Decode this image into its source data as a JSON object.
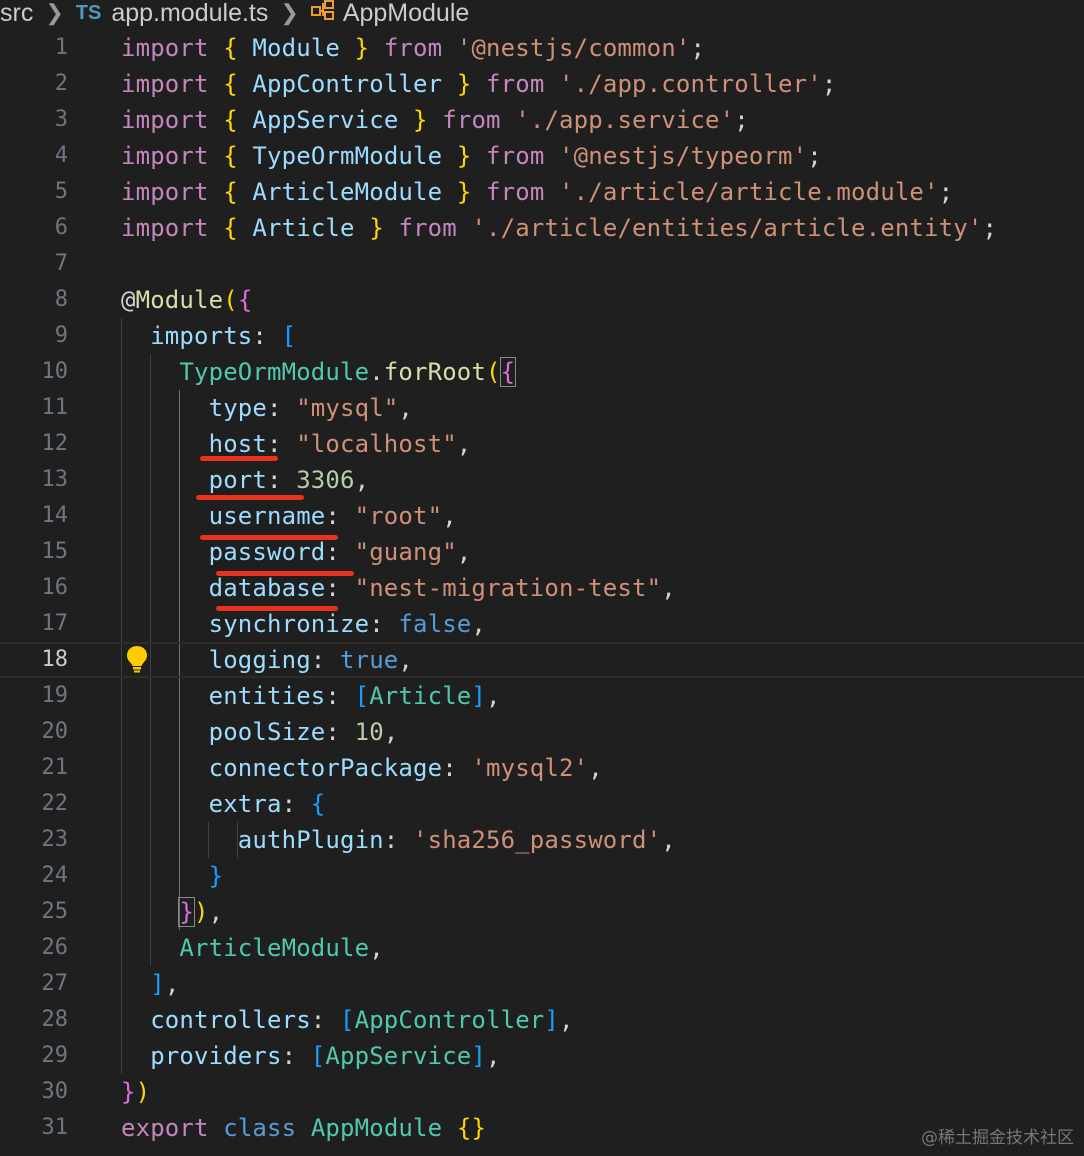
{
  "breadcrumb": {
    "folder": "src",
    "file_icon": "TS",
    "file": "app.module.ts",
    "symbol_icon": "class-icon",
    "symbol": "AppModule"
  },
  "editor": {
    "current_line": 18,
    "line_numbers": [
      "1",
      "2",
      "3",
      "4",
      "5",
      "6",
      "7",
      "8",
      "9",
      "10",
      "11",
      "12",
      "13",
      "14",
      "15",
      "16",
      "17",
      "18",
      "19",
      "20",
      "21",
      "22",
      "23",
      "24",
      "25",
      "26",
      "27",
      "28",
      "29",
      "30",
      "31"
    ],
    "lines": [
      [
        {
          "t": "import",
          "c": "kw"
        },
        {
          "t": " ",
          "c": "punc"
        },
        {
          "t": "{",
          "c": "br"
        },
        {
          "t": " Module ",
          "c": "var"
        },
        {
          "t": "}",
          "c": "br"
        },
        {
          "t": " from ",
          "c": "kw"
        },
        {
          "t": "'@nestjs/common'",
          "c": "str"
        },
        {
          "t": ";",
          "c": "punc"
        }
      ],
      [
        {
          "t": "import",
          "c": "kw"
        },
        {
          "t": " ",
          "c": "punc"
        },
        {
          "t": "{",
          "c": "br"
        },
        {
          "t": " AppController ",
          "c": "var"
        },
        {
          "t": "}",
          "c": "br"
        },
        {
          "t": " from ",
          "c": "kw"
        },
        {
          "t": "'./app.controller'",
          "c": "str"
        },
        {
          "t": ";",
          "c": "punc"
        }
      ],
      [
        {
          "t": "import",
          "c": "kw"
        },
        {
          "t": " ",
          "c": "punc"
        },
        {
          "t": "{",
          "c": "br"
        },
        {
          "t": " AppService ",
          "c": "var"
        },
        {
          "t": "}",
          "c": "br"
        },
        {
          "t": " from ",
          "c": "kw"
        },
        {
          "t": "'./app.service'",
          "c": "str"
        },
        {
          "t": ";",
          "c": "punc"
        }
      ],
      [
        {
          "t": "import",
          "c": "kw"
        },
        {
          "t": " ",
          "c": "punc"
        },
        {
          "t": "{",
          "c": "br"
        },
        {
          "t": " TypeOrmModule ",
          "c": "var"
        },
        {
          "t": "}",
          "c": "br"
        },
        {
          "t": " from ",
          "c": "kw"
        },
        {
          "t": "'@nestjs/typeorm'",
          "c": "str"
        },
        {
          "t": ";",
          "c": "punc"
        }
      ],
      [
        {
          "t": "import",
          "c": "kw"
        },
        {
          "t": " ",
          "c": "punc"
        },
        {
          "t": "{",
          "c": "br"
        },
        {
          "t": " ArticleModule ",
          "c": "var"
        },
        {
          "t": "}",
          "c": "br"
        },
        {
          "t": " from ",
          "c": "kw"
        },
        {
          "t": "'./article/article.module'",
          "c": "str"
        },
        {
          "t": ";",
          "c": "punc"
        }
      ],
      [
        {
          "t": "import",
          "c": "kw"
        },
        {
          "t": " ",
          "c": "punc"
        },
        {
          "t": "{",
          "c": "br"
        },
        {
          "t": " Article ",
          "c": "var"
        },
        {
          "t": "}",
          "c": "br"
        },
        {
          "t": " from ",
          "c": "kw"
        },
        {
          "t": "'./article/entities/article.entity'",
          "c": "str"
        },
        {
          "t": ";",
          "c": "punc"
        }
      ],
      [],
      [
        {
          "t": "@",
          "c": "punc"
        },
        {
          "t": "Module",
          "c": "dec"
        },
        {
          "t": "(",
          "c": "br"
        },
        {
          "t": "{",
          "c": "br2"
        }
      ],
      [
        {
          "t": "  imports",
          "c": "var"
        },
        {
          "t": ": ",
          "c": "punc"
        },
        {
          "t": "[",
          "c": "br3"
        }
      ],
      [
        {
          "t": "    TypeOrmModule",
          "c": "cls"
        },
        {
          "t": ".",
          "c": "punc"
        },
        {
          "t": "forRoot",
          "c": "fn"
        },
        {
          "t": "(",
          "c": "br"
        },
        {
          "t": "{",
          "c": "br2 bracket-box"
        }
      ],
      [
        {
          "t": "      type",
          "c": "var"
        },
        {
          "t": ": ",
          "c": "punc"
        },
        {
          "t": "\"mysql\"",
          "c": "str"
        },
        {
          "t": ",",
          "c": "punc"
        }
      ],
      [
        {
          "t": "      host",
          "c": "var"
        },
        {
          "t": ": ",
          "c": "punc"
        },
        {
          "t": "\"localhost\"",
          "c": "str"
        },
        {
          "t": ",",
          "c": "punc"
        }
      ],
      [
        {
          "t": "      port",
          "c": "var"
        },
        {
          "t": ": ",
          "c": "punc"
        },
        {
          "t": "3306",
          "c": "num"
        },
        {
          "t": ",",
          "c": "punc"
        }
      ],
      [
        {
          "t": "      username",
          "c": "var"
        },
        {
          "t": ": ",
          "c": "punc"
        },
        {
          "t": "\"root\"",
          "c": "str"
        },
        {
          "t": ",",
          "c": "punc"
        }
      ],
      [
        {
          "t": "      password",
          "c": "var"
        },
        {
          "t": ": ",
          "c": "punc"
        },
        {
          "t": "\"guang\"",
          "c": "str"
        },
        {
          "t": ",",
          "c": "punc"
        }
      ],
      [
        {
          "t": "      database",
          "c": "var"
        },
        {
          "t": ": ",
          "c": "punc"
        },
        {
          "t": "\"nest-migration-test\"",
          "c": "str"
        },
        {
          "t": ",",
          "c": "punc"
        }
      ],
      [
        {
          "t": "      synchronize",
          "c": "var"
        },
        {
          "t": ": ",
          "c": "punc"
        },
        {
          "t": "false",
          "c": "bool"
        },
        {
          "t": ",",
          "c": "punc"
        }
      ],
      [
        {
          "t": "      logging",
          "c": "var"
        },
        {
          "t": ": ",
          "c": "punc"
        },
        {
          "t": "true",
          "c": "bool"
        },
        {
          "t": ",",
          "c": "punc"
        }
      ],
      [
        {
          "t": "      entities",
          "c": "var"
        },
        {
          "t": ": ",
          "c": "punc"
        },
        {
          "t": "[",
          "c": "br3"
        },
        {
          "t": "Article",
          "c": "cls"
        },
        {
          "t": "]",
          "c": "br3"
        },
        {
          "t": ",",
          "c": "punc"
        }
      ],
      [
        {
          "t": "      poolSize",
          "c": "var"
        },
        {
          "t": ": ",
          "c": "punc"
        },
        {
          "t": "10",
          "c": "num"
        },
        {
          "t": ",",
          "c": "punc"
        }
      ],
      [
        {
          "t": "      connectorPackage",
          "c": "var"
        },
        {
          "t": ": ",
          "c": "punc"
        },
        {
          "t": "'mysql2'",
          "c": "str"
        },
        {
          "t": ",",
          "c": "punc"
        }
      ],
      [
        {
          "t": "      extra",
          "c": "var"
        },
        {
          "t": ": ",
          "c": "punc"
        },
        {
          "t": "{",
          "c": "br3"
        }
      ],
      [
        {
          "t": "        authPlugin",
          "c": "var"
        },
        {
          "t": ": ",
          "c": "punc"
        },
        {
          "t": "'sha256_password'",
          "c": "str"
        },
        {
          "t": ",",
          "c": "punc"
        }
      ],
      [
        {
          "t": "      }",
          "c": "br3"
        }
      ],
      [
        {
          "t": "    ",
          "c": "punc"
        },
        {
          "t": "}",
          "c": "br2 bracket-box"
        },
        {
          "t": ")",
          "c": "br"
        },
        {
          "t": ",",
          "c": "punc"
        }
      ],
      [
        {
          "t": "    ArticleModule",
          "c": "cls"
        },
        {
          "t": ",",
          "c": "punc"
        }
      ],
      [
        {
          "t": "  ]",
          "c": "br3"
        },
        {
          "t": ",",
          "c": "punc"
        }
      ],
      [
        {
          "t": "  controllers",
          "c": "var"
        },
        {
          "t": ": ",
          "c": "punc"
        },
        {
          "t": "[",
          "c": "br3"
        },
        {
          "t": "AppController",
          "c": "cls"
        },
        {
          "t": "]",
          "c": "br3"
        },
        {
          "t": ",",
          "c": "punc"
        }
      ],
      [
        {
          "t": "  providers",
          "c": "var"
        },
        {
          "t": ": ",
          "c": "punc"
        },
        {
          "t": "[",
          "c": "br3"
        },
        {
          "t": "AppService",
          "c": "cls"
        },
        {
          "t": "]",
          "c": "br3"
        },
        {
          "t": ",",
          "c": "punc"
        }
      ],
      [
        {
          "t": "}",
          "c": "br2"
        },
        {
          "t": ")",
          "c": "br"
        }
      ],
      [
        {
          "t": "export",
          "c": "kw"
        },
        {
          "t": " ",
          "c": "punc"
        },
        {
          "t": "class",
          "c": "kw2"
        },
        {
          "t": " ",
          "c": "punc"
        },
        {
          "t": "AppModule",
          "c": "cls"
        },
        {
          "t": " ",
          "c": "punc"
        },
        {
          "t": "{}",
          "c": "br"
        }
      ]
    ]
  },
  "lightbulb_icon": "lightbulb-icon",
  "watermark": "@稀土掘金技术社区",
  "colors": {
    "background": "#1f1f1f",
    "underline": "#e8321d",
    "keyword": "#c586c0",
    "string": "#ce9178",
    "property": "#9cdcfe",
    "class": "#4ec9b0"
  }
}
